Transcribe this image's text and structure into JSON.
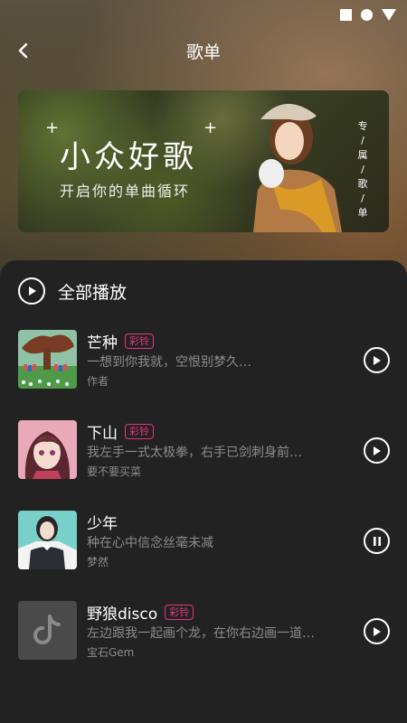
{
  "nav": {
    "title": "歌单"
  },
  "banner": {
    "title": "小众好歌",
    "subtitle": "开启你的单曲循环",
    "vertical_text": [
      "专",
      "/",
      "属",
      "/",
      "歌",
      "/",
      "单"
    ]
  },
  "playall": {
    "label": "全部播放"
  },
  "songs": [
    {
      "title": "芒种",
      "badge": "彩铃",
      "line": "一想到你我就，空恨别梦久…",
      "artist": "作者",
      "state": "play",
      "cover": "tree-illustration"
    },
    {
      "title": "下山",
      "badge": "彩铃",
      "line": "我左手一式太极拳，右手已剑刺身前…",
      "artist": "要不要买菜",
      "state": "play",
      "cover": "anime-girl"
    },
    {
      "title": "少年",
      "badge": "",
      "line": "种在心中信念丝毫未减",
      "artist": "梦然",
      "state": "pause",
      "cover": "girl-photo"
    },
    {
      "title": "野狼disco",
      "badge": "彩铃",
      "line": "左边跟我一起画个龙，在你右边画一道…",
      "artist": "宝石Gem",
      "state": "play",
      "cover": "tiktok-logo"
    }
  ],
  "colors": {
    "accent": "#e6347d",
    "panel": "#222222",
    "secondary_text": "#8c8c8c"
  }
}
